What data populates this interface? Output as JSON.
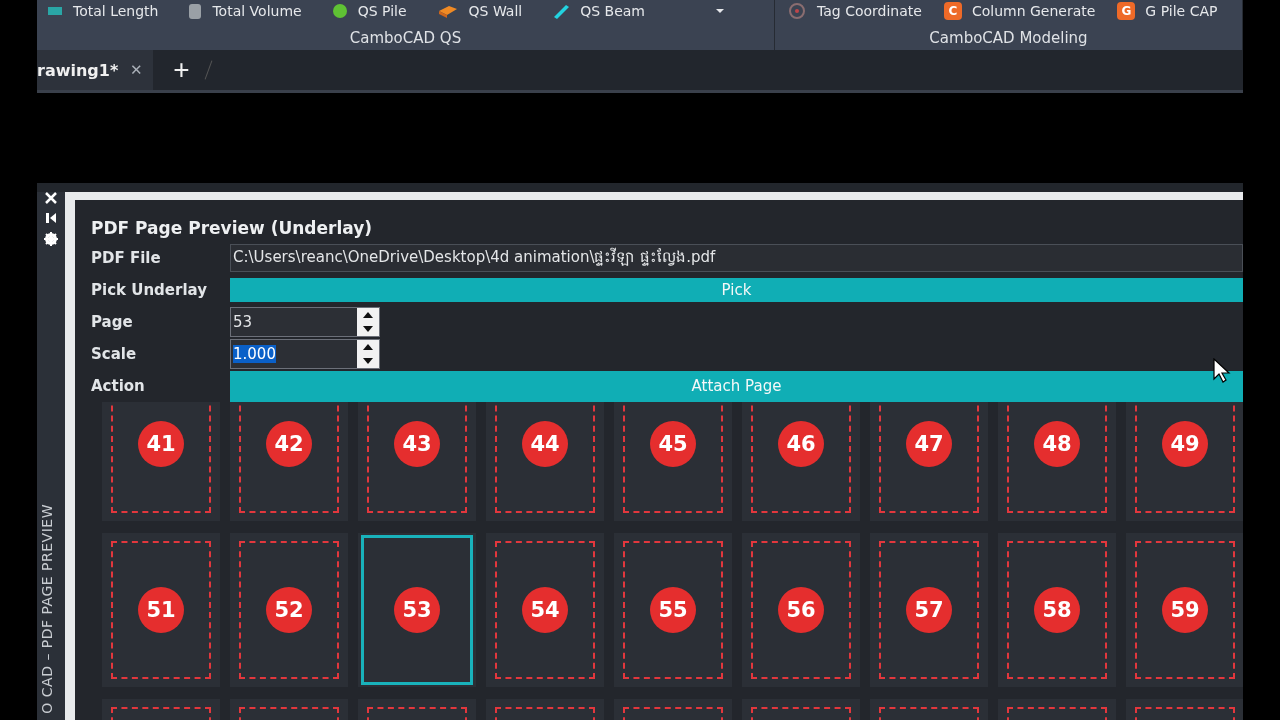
{
  "ribbon": {
    "groups": [
      {
        "label": "CamboCAD QS",
        "items": [
          {
            "kind": "length",
            "label": "Total Length"
          },
          {
            "kind": "cylinder",
            "label": "Total Volume"
          },
          {
            "kind": "dot",
            "label": "QS Pile"
          },
          {
            "kind": "brick",
            "label": "QS Wall"
          },
          {
            "kind": "beam",
            "label": "QS Beam"
          },
          {
            "kind": "caret"
          }
        ]
      },
      {
        "label": "CamboCAD Modeling",
        "items": [
          {
            "kind": "target",
            "label": "Tag Coordinate"
          },
          {
            "kind": "letter",
            "icon_letter": "C",
            "label": "Column Generate"
          },
          {
            "kind": "letter",
            "icon_letter": "G",
            "label": "G Pile CAP"
          }
        ]
      }
    ]
  },
  "tabs": [
    {
      "label": "rawing1*",
      "close": "✕"
    }
  ],
  "new_tab": "+",
  "palette": {
    "side_title": "O CAD – PDF PAGE PREVIEW",
    "title": "PDF Page Preview (Underlay)",
    "rows": [
      {
        "kind": "field",
        "label": "PDF File",
        "value": "C:\\Users\\reanc\\OneDrive\\Desktop\\4d animation\\ផ្ទះវីឡា ផ្ទះល្វែង.pdf"
      },
      {
        "kind": "button",
        "label": "Pick Underlay",
        "button": "Pick"
      },
      {
        "kind": "spinner",
        "label": "Page",
        "value": "53",
        "text_selected": false
      },
      {
        "kind": "spinner",
        "label": "Scale",
        "value": "1.000",
        "text_selected": true
      },
      {
        "kind": "button",
        "label": "Action",
        "button": "Attach Page"
      }
    ],
    "page_rows": [
      {
        "pages": [
          {
            "number": "41",
            "selected": false
          },
          {
            "number": "42",
            "selected": false
          },
          {
            "number": "43",
            "selected": false
          },
          {
            "number": "44",
            "selected": false
          },
          {
            "number": "45",
            "selected": false
          },
          {
            "number": "46",
            "selected": false
          },
          {
            "number": "47",
            "selected": false
          },
          {
            "number": "48",
            "selected": false
          },
          {
            "number": "49",
            "selected": false
          }
        ]
      },
      {
        "pages": [
          {
            "number": "51",
            "selected": false
          },
          {
            "number": "52",
            "selected": false
          },
          {
            "number": "53",
            "selected": true
          },
          {
            "number": "54",
            "selected": false
          },
          {
            "number": "55",
            "selected": false
          },
          {
            "number": "56",
            "selected": false
          },
          {
            "number": "57",
            "selected": false
          },
          {
            "number": "58",
            "selected": false
          },
          {
            "number": "59",
            "selected": false
          }
        ]
      },
      {
        "pages": [
          {
            "selected": false
          },
          {
            "selected": false
          },
          {
            "selected": false
          },
          {
            "selected": false
          },
          {
            "selected": false
          },
          {
            "selected": false
          },
          {
            "selected": false
          },
          {
            "selected": false
          },
          {
            "selected": false
          }
        ]
      }
    ]
  }
}
